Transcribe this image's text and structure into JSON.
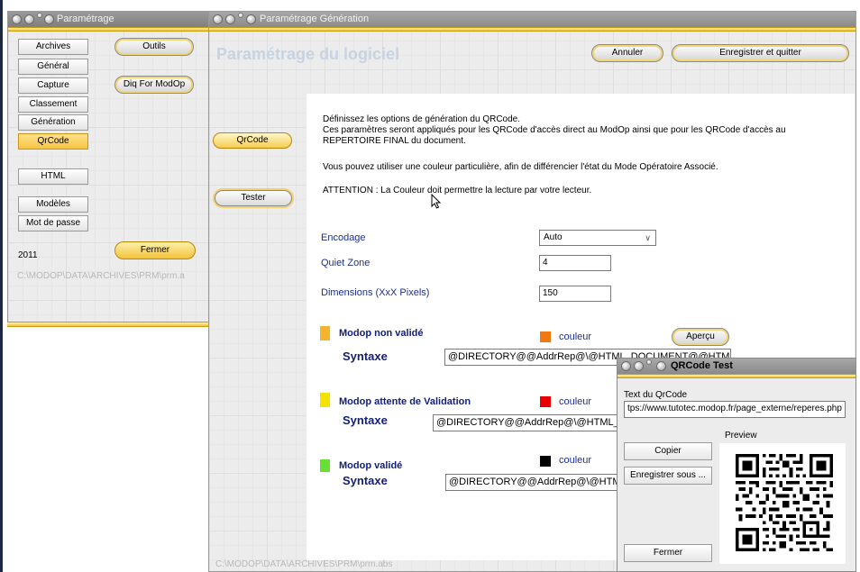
{
  "window_left": {
    "title": "Paramétrage",
    "nav_items": [
      {
        "label": "Archives"
      },
      {
        "label": "Général"
      },
      {
        "label": "Capture"
      },
      {
        "label": "Classement"
      },
      {
        "label": "Génération"
      },
      {
        "label": "QrCode"
      },
      {
        "label": "HTML"
      },
      {
        "label": "Modèles"
      },
      {
        "label": "Mot de passe"
      }
    ],
    "outils_label": "Outils",
    "diq_label": "Diq For ModOp",
    "fermer_label": "Fermer",
    "year": "2011",
    "path": "C:\\MODOP\\DATA\\ARCHIVES\\PRM\\prm.a"
  },
  "window_main": {
    "title": "Paramétrage Génération",
    "heading": "Paramétrage du logiciel",
    "annuler_label": "Annuler",
    "save_quit_label": "Enregistrer et quitter",
    "side_qrcode_label": "QrCode",
    "side_tester_label": "Tester",
    "intro_lines": [
      "Définissez les options de génération du QRCode.",
      "Ces paramètres seront appliqués pour les QRCode d'accès direct au ModOp ainsi que pour les QRCode d'accès au",
      "REPERTOIRE FINAL du document.",
      "Vous pouvez utiliser une couleur particulière, afin de différencier l'état du Mode Opératoire Associé.",
      "ATTENTION : La Couleur doit permettre la lecture par votre lecteur."
    ],
    "encodage_label": "Encodage",
    "encodage_value": "Auto",
    "quiet_zone_label": "Quiet Zone",
    "quiet_zone_value": "4",
    "dimensions_label": "Dimensions (XxX Pixels)",
    "dimensions_value": "150",
    "apercu_label": "Aperçu",
    "path": "C:\\MODOP\\DATA\\ARCHIVES\\PRM\\prm.abs",
    "states": [
      {
        "title": "Modop non validé",
        "syntax_label": "Syntaxe",
        "syntax_value": "@DIRECTORY@@AddrRep@\\@HTML_DOCUMENT@@HTML_DOC",
        "couleur_label": "couleur",
        "state_color": "#f7b32b",
        "qr_color": "#ef7a12"
      },
      {
        "title": "Modop attente de Validation",
        "syntax_label": "Syntaxe",
        "syntax_value": "@DIRECTORY@@AddrRep@\\@HTML_DOC",
        "couleur_label": "couleur",
        "state_color": "#f4e200",
        "qr_color": "#e60000"
      },
      {
        "title": "Modop validé",
        "syntax_label": "Syntaxe",
        "syntax_value": "@DIRECTORY@@AddrRep@\\@HTML_DOC",
        "couleur_label": "couleur",
        "state_color": "#66e033",
        "qr_color": "#000000"
      }
    ]
  },
  "window_qr": {
    "title": "QRCode Test",
    "text_label": "Text du QrCode",
    "text_value": "tps://www.tutotec.modop.fr/page_externe/reperes.php",
    "copier_label": "Copier",
    "save_as_label": "Enregistrer sous ...",
    "preview_label": "Preview",
    "fermer_label": "Fermer"
  }
}
